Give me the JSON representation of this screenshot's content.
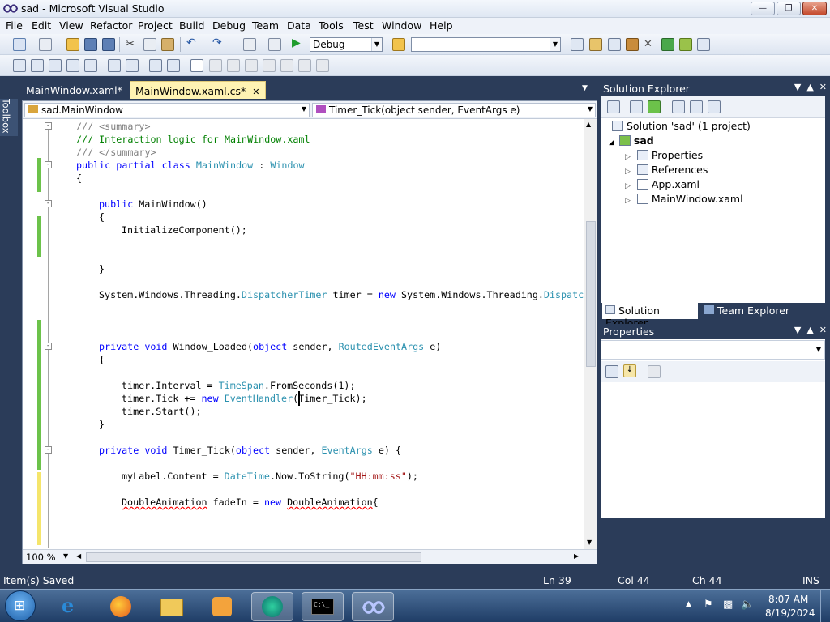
{
  "window": {
    "title": "sad - Microsoft Visual Studio",
    "min": "0",
    "max": "1",
    "close": "r"
  },
  "menu": [
    "File",
    "Edit",
    "View",
    "Refactor",
    "Project",
    "Build",
    "Debug",
    "Team",
    "Data",
    "Tools",
    "Test",
    "Window",
    "Help"
  ],
  "toolbar": {
    "config": "Debug",
    "platform": ""
  },
  "toolbox_label": "Toolbox",
  "tabs": [
    {
      "label": "MainWindow.xaml*",
      "active": false
    },
    {
      "label": "MainWindow.xaml.cs*",
      "active": true
    }
  ],
  "nav": {
    "class": "sad.MainWindow",
    "member": "Timer_Tick(object sender, EventArgs e)"
  },
  "code": {
    "l1": "/// <summary>",
    "l2": "/// Interaction logic for MainWindow.xaml",
    "l3": "/// </summary>",
    "l4a": "public",
    "l4b": "partial",
    "l4c": "class",
    "l4d": "MainWindow",
    "l4e": " : ",
    "l4f": "Window",
    "l5": "{",
    "l6a": "public",
    "l6b": " MainWindow()",
    "l7": "{",
    "l8": "InitializeComponent();",
    "l9": "}",
    "l10a": "System.Windows.Threading.",
    "l10b": "DispatcherTimer",
    "l10c": " timer = ",
    "l10d": "new",
    "l10e": " System.Windows.Threading.",
    "l10f": "Dispatch",
    "l11a": "private",
    "l11b": "void",
    "l11c": " Window_Loaded(",
    "l11d": "object",
    "l11e": " sender, ",
    "l11f": "RoutedEventArgs",
    "l11g": " e)",
    "l12": "{",
    "l13a": "timer.Interval = ",
    "l13b": "TimeSpan",
    "l13c": ".FromSeconds(1);",
    "l14a": "timer.Tick += ",
    "l14b": "new",
    "l14c": " ",
    "l14d": "EventHandler",
    "l14e": "(Timer_Tick);",
    "l15": "timer.Start();",
    "l16": "}",
    "l17a": "private",
    "l17b": "void",
    "l17c": " Timer_Tick(",
    "l17d": "object",
    "l17e": " sender, ",
    "l17f": "EventArgs",
    "l17g": " e) {",
    "l18a": "myLabel.Content = ",
    "l18b": "DateTime",
    "l18c": ".Now.ToString(",
    "l18d": "\"HH:mm:ss\"",
    "l18e": ");",
    "l19a": "DoubleAnimation",
    "l19b": " fadeIn = ",
    "l19c": "new",
    "l19d": " ",
    "l19e": "DoubleAnimation",
    "l19f": "{"
  },
  "zoom": "100 %",
  "solution_explorer": {
    "title": "Solution Explorer",
    "solution": "Solution 'sad' (1 project)",
    "project": "sad",
    "items": [
      "Properties",
      "References",
      "App.xaml",
      "MainWindow.xaml"
    ]
  },
  "panel_tabs": [
    "Solution Explorer",
    "Team Explorer"
  ],
  "properties": {
    "title": "Properties"
  },
  "status": {
    "message": "Item(s) Saved",
    "ln": "Ln 39",
    "col": "Col 44",
    "ch": "Ch 44",
    "mode": "INS"
  },
  "clock": {
    "time": "8:07 AM",
    "date": "8/19/2024"
  },
  "colors": {
    "chrome": "#2b3c59",
    "keyword": "#0000ff",
    "type": "#2b91af",
    "comment": "#008000",
    "string": "#a31515",
    "active_tab": "#fff3b3"
  }
}
